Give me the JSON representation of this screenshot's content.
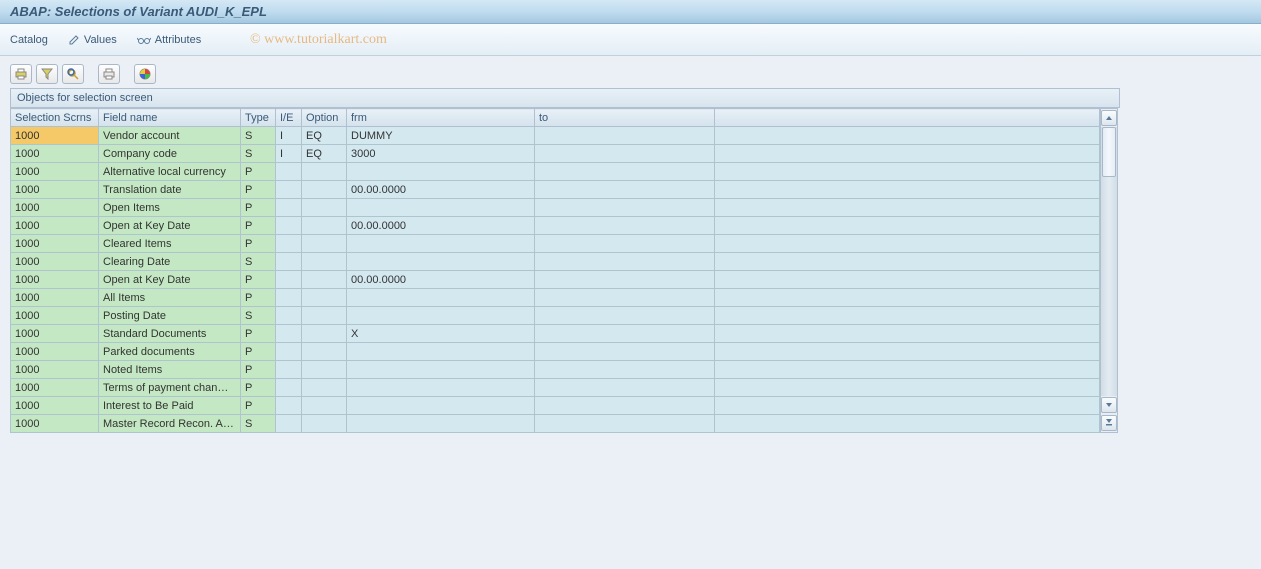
{
  "title": "ABAP: Selections of Variant AUDI_K_EPL",
  "menu": {
    "catalog": "Catalog",
    "values": "Values",
    "attributes": "Attributes"
  },
  "watermark": "© www.tutorialkart.com",
  "panel_title": "Objects for selection screen",
  "columns": {
    "scrn": "Selection Scrns",
    "field": "Field name",
    "type": "Type",
    "ie": "I/E",
    "opt": "Option",
    "frm": "frm",
    "to": "to"
  },
  "rows": [
    {
      "scrn": "1000",
      "field": "Vendor account",
      "type": "S",
      "ie": "I",
      "opt": "EQ",
      "frm": "DUMMY",
      "to": "",
      "highlight": true
    },
    {
      "scrn": "1000",
      "field": "Company code",
      "type": "S",
      "ie": "I",
      "opt": "EQ",
      "frm": "3000",
      "to": ""
    },
    {
      "scrn": "1000",
      "field": "Alternative local currency",
      "type": "P",
      "ie": "",
      "opt": "",
      "frm": "",
      "to": ""
    },
    {
      "scrn": "1000",
      "field": "Translation date",
      "type": "P",
      "ie": "",
      "opt": "",
      "frm": "00.00.0000",
      "to": ""
    },
    {
      "scrn": "1000",
      "field": "Open Items",
      "type": "P",
      "ie": "",
      "opt": "",
      "frm": "",
      "to": ""
    },
    {
      "scrn": "1000",
      "field": "Open at Key Date",
      "type": "P",
      "ie": "",
      "opt": "",
      "frm": "00.00.0000",
      "to": ""
    },
    {
      "scrn": "1000",
      "field": "Cleared Items",
      "type": "P",
      "ie": "",
      "opt": "",
      "frm": "",
      "to": ""
    },
    {
      "scrn": "1000",
      "field": "Clearing Date",
      "type": "S",
      "ie": "",
      "opt": "",
      "frm": "",
      "to": ""
    },
    {
      "scrn": "1000",
      "field": "Open at Key Date",
      "type": "P",
      "ie": "",
      "opt": "",
      "frm": "00.00.0000",
      "to": ""
    },
    {
      "scrn": "1000",
      "field": "All Items",
      "type": "P",
      "ie": "",
      "opt": "",
      "frm": "",
      "to": ""
    },
    {
      "scrn": "1000",
      "field": "Posting Date",
      "type": "S",
      "ie": "",
      "opt": "",
      "frm": "",
      "to": ""
    },
    {
      "scrn": "1000",
      "field": "Standard Documents",
      "type": "P",
      "ie": "",
      "opt": "",
      "frm": "X",
      "to": ""
    },
    {
      "scrn": "1000",
      "field": "Parked documents",
      "type": "P",
      "ie": "",
      "opt": "",
      "frm": "",
      "to": ""
    },
    {
      "scrn": "1000",
      "field": "Noted Items",
      "type": "P",
      "ie": "",
      "opt": "",
      "frm": "",
      "to": ""
    },
    {
      "scrn": "1000",
      "field": "Terms of payment chan…",
      "type": "P",
      "ie": "",
      "opt": "",
      "frm": "",
      "to": ""
    },
    {
      "scrn": "1000",
      "field": "Interest to Be Paid",
      "type": "P",
      "ie": "",
      "opt": "",
      "frm": "",
      "to": ""
    },
    {
      "scrn": "1000",
      "field": "Master Record Recon. A…",
      "type": "S",
      "ie": "",
      "opt": "",
      "frm": "",
      "to": ""
    }
  ]
}
